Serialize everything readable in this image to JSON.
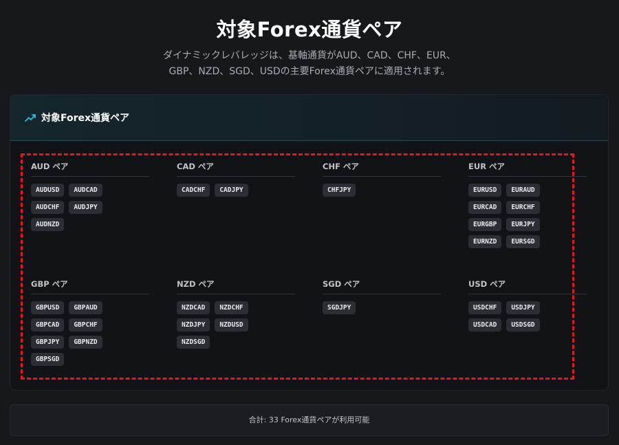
{
  "header": {
    "title": "対象Forex通貨ペア",
    "subtitle_line1": "ダイナミックレバレッジは、基軸通貨がAUD、CAD、CHF、EUR、",
    "subtitle_line2": "GBP、NZD、SGD、USDの主要Forex通貨ペアに適用されます。"
  },
  "panel": {
    "icon": "trending-up-icon",
    "title": "対象Forex通貨ペア",
    "accent_color": "#22c1e6",
    "highlight_color": "#e11b1b",
    "groups": [
      {
        "title": "AUD ペア",
        "pairs": [
          "AUDUSD",
          "AUDCAD",
          "AUDCHF",
          "AUDJPY",
          "AUDNZD"
        ]
      },
      {
        "title": "CAD ペア",
        "pairs": [
          "CADCHF",
          "CADJPY"
        ]
      },
      {
        "title": "CHF ペア",
        "pairs": [
          "CHFJPY"
        ]
      },
      {
        "title": "EUR ペア",
        "pairs": [
          "EURUSD",
          "EURAUD",
          "EURCAD",
          "EURCHF",
          "EURGBP",
          "EURJPY",
          "EURNZD",
          "EURSGD"
        ]
      },
      {
        "title": "GBP ペア",
        "pairs": [
          "GBPUSD",
          "GBPAUD",
          "GBPCAD",
          "GBPCHF",
          "GBPJPY",
          "GBPNZD",
          "GBPSGD"
        ]
      },
      {
        "title": "NZD ペア",
        "pairs": [
          "NZDCAD",
          "NZDCHF",
          "NZDJPY",
          "NZDUSD",
          "NZDSGD"
        ]
      },
      {
        "title": "SGD ペア",
        "pairs": [
          "SGDJPY"
        ]
      },
      {
        "title": "USD ペア",
        "pairs": [
          "USDCHF",
          "USDJPY",
          "USDCAD",
          "USDSGD"
        ]
      }
    ]
  },
  "footer": {
    "text": "合計: 33 Forex通貨ペアが利用可能"
  }
}
